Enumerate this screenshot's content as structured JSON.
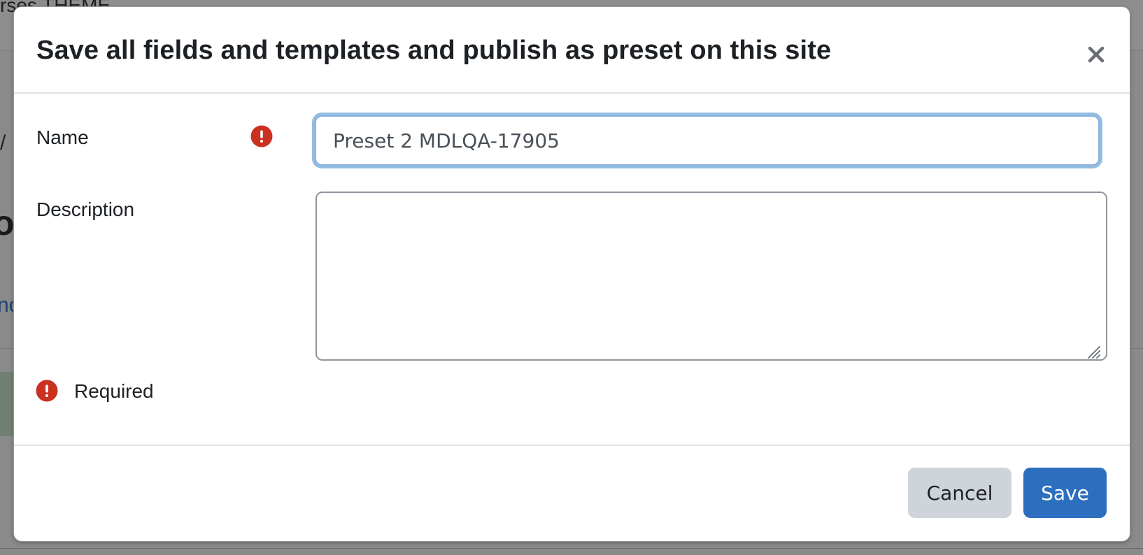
{
  "background": {
    "breadcrumb": "rses  THEME",
    "slash": "/",
    "heading_fragment": "o",
    "link_fragment": "nc"
  },
  "dialog": {
    "title": "Save all fields and templates and publish as preset on this site",
    "close_icon": "close-icon",
    "fields": {
      "name": {
        "label": "Name",
        "value": "Preset 2 MDLQA-17905",
        "required_icon": "exclamation-circle-icon"
      },
      "description": {
        "label": "Description",
        "value": ""
      }
    },
    "required_legend": "Required",
    "buttons": {
      "cancel": "Cancel",
      "save": "Save"
    }
  },
  "colors": {
    "primary": "#0f6cbf",
    "required": "#ca3120",
    "secondary_button": "#ced4da"
  }
}
